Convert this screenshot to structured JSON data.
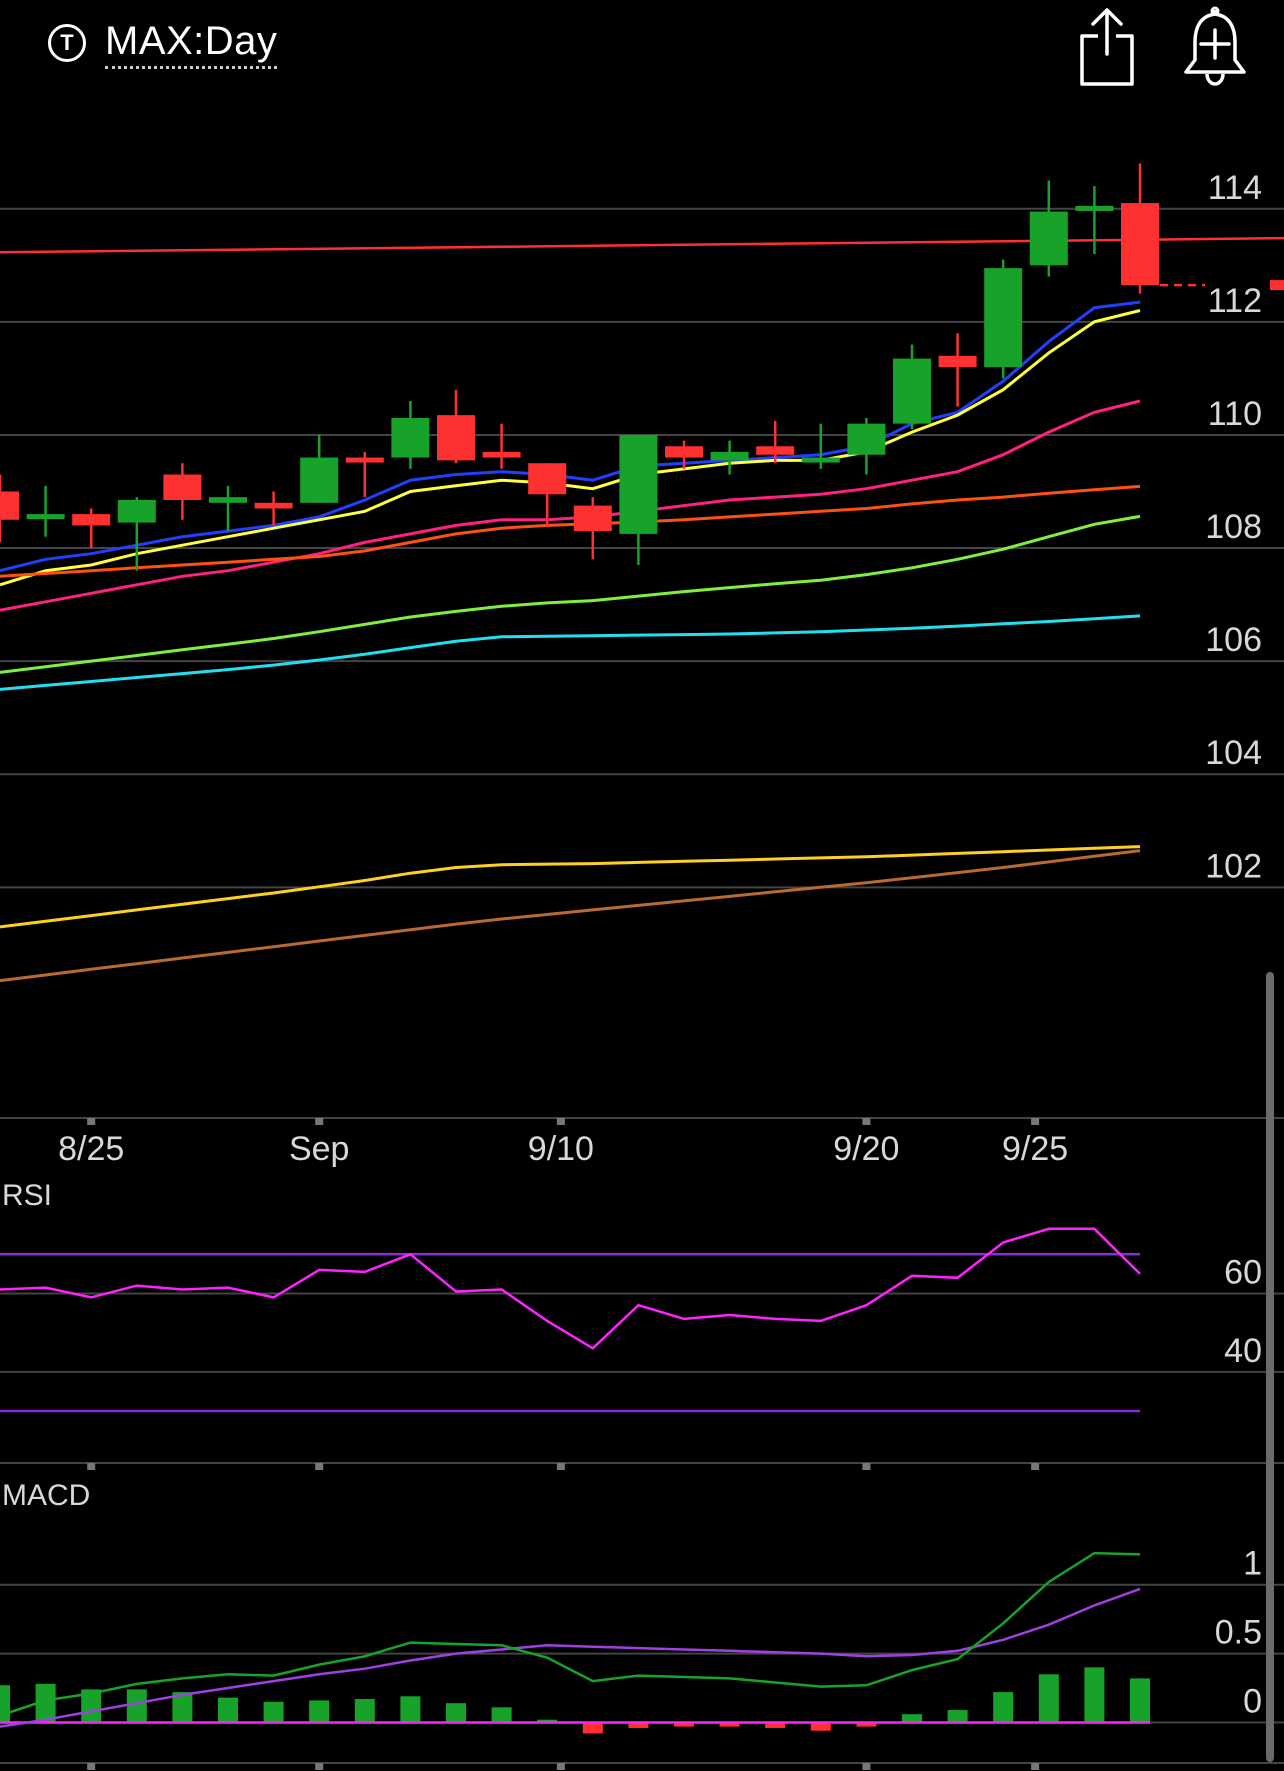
{
  "header": {
    "ticker_icon": "T",
    "title": "MAX:Day",
    "share_icon": "share-icon",
    "alert_icon": "add-alert-bell-icon"
  },
  "colors": {
    "up": "#17a32a",
    "down": "#ff3030",
    "grid": "#444444",
    "axis_text": "#d8d8d8",
    "rsi_line": "#ff22ff",
    "rsi_band": "#8a2be2",
    "macd_line": "#17a32a",
    "signal_line": "#a040e0",
    "macd_zero": "#ff22ff"
  },
  "chart_data": [
    {
      "type": "candlestick",
      "title": "MAX:Day",
      "y_ticks": [
        114,
        112,
        110,
        108,
        106,
        104,
        102
      ],
      "ylim": [
        99.3,
        116.1
      ],
      "x_ticks": [
        {
          "label": "8/25",
          "index": 2
        },
        {
          "label": "Sep",
          "index": 7
        },
        {
          "label": "9/10",
          "index": 12.3
        },
        {
          "label": "9/20",
          "index": 19
        },
        {
          "label": "9/25",
          "index": 22.7
        }
      ],
      "candles": [
        {
          "o": 109.0,
          "h": 109.3,
          "l": 108.1,
          "c": 108.5
        },
        {
          "o": 108.6,
          "h": 109.1,
          "l": 108.2,
          "c": 108.6
        },
        {
          "o": 108.6,
          "h": 108.7,
          "l": 108.0,
          "c": 108.4
        },
        {
          "o": 108.45,
          "h": 108.9,
          "l": 107.6,
          "c": 108.85
        },
        {
          "o": 109.3,
          "h": 109.5,
          "l": 108.5,
          "c": 108.85
        },
        {
          "o": 108.8,
          "h": 109.1,
          "l": 108.3,
          "c": 108.9
        },
        {
          "o": 108.8,
          "h": 109.0,
          "l": 108.4,
          "c": 108.7
        },
        {
          "o": 108.8,
          "h": 110.0,
          "l": 108.8,
          "c": 109.6
        },
        {
          "o": 109.6,
          "h": 109.7,
          "l": 108.9,
          "c": 109.55
        },
        {
          "o": 109.6,
          "h": 110.6,
          "l": 109.4,
          "c": 110.3
        },
        {
          "o": 110.35,
          "h": 110.8,
          "l": 109.5,
          "c": 109.55
        },
        {
          "o": 109.7,
          "h": 110.2,
          "l": 109.4,
          "c": 109.6
        },
        {
          "o": 109.5,
          "h": 109.5,
          "l": 108.4,
          "c": 108.95
        },
        {
          "o": 108.75,
          "h": 108.9,
          "l": 107.8,
          "c": 108.3
        },
        {
          "o": 108.25,
          "h": 110.0,
          "l": 107.7,
          "c": 110.0
        },
        {
          "o": 109.8,
          "h": 109.9,
          "l": 109.4,
          "c": 109.6
        },
        {
          "o": 109.55,
          "h": 109.9,
          "l": 109.3,
          "c": 109.7
        },
        {
          "o": 109.8,
          "h": 110.25,
          "l": 109.5,
          "c": 109.65
        },
        {
          "o": 109.55,
          "h": 110.2,
          "l": 109.4,
          "c": 109.6
        },
        {
          "o": 109.65,
          "h": 110.3,
          "l": 109.3,
          "c": 110.2
        },
        {
          "o": 110.2,
          "h": 111.6,
          "l": 110.1,
          "c": 111.35
        },
        {
          "o": 111.4,
          "h": 111.8,
          "l": 110.5,
          "c": 111.2
        },
        {
          "o": 111.2,
          "h": 113.1,
          "l": 111.0,
          "c": 112.95
        },
        {
          "o": 113.0,
          "h": 114.5,
          "l": 112.8,
          "c": 113.95
        },
        {
          "o": 114.0,
          "h": 114.4,
          "l": 113.2,
          "c": 114.05
        },
        {
          "o": 114.1,
          "h": 114.8,
          "l": 112.5,
          "c": 112.65
        }
      ],
      "series": [
        {
          "color": "#2040ff",
          "values": [
            107.6,
            107.8,
            107.9,
            108.05,
            108.2,
            108.3,
            108.4,
            108.55,
            108.85,
            109.2,
            109.3,
            109.35,
            109.3,
            109.2,
            109.45,
            109.5,
            109.55,
            109.6,
            109.65,
            109.8,
            110.2,
            110.4,
            110.95,
            111.65,
            112.25,
            112.35
          ]
        },
        {
          "color": "#ffff40",
          "values": [
            107.35,
            107.6,
            107.7,
            107.9,
            108.05,
            108.2,
            108.35,
            108.5,
            108.65,
            109.0,
            109.1,
            109.2,
            109.15,
            109.05,
            109.3,
            109.4,
            109.5,
            109.55,
            109.55,
            109.7,
            110.05,
            110.35,
            110.8,
            111.45,
            112.0,
            112.2
          ]
        },
        {
          "color": "#ff2080",
          "values": [
            106.9,
            107.05,
            107.2,
            107.35,
            107.5,
            107.6,
            107.75,
            107.9,
            108.1,
            108.25,
            108.4,
            108.5,
            108.5,
            108.55,
            108.65,
            108.75,
            108.85,
            108.9,
            108.95,
            109.05,
            109.2,
            109.35,
            109.65,
            110.05,
            110.4,
            110.6
          ]
        },
        {
          "color": "#ff5010",
          "values": [
            107.5,
            107.55,
            107.6,
            107.65,
            107.7,
            107.75,
            107.8,
            107.85,
            107.95,
            108.1,
            108.25,
            108.35,
            108.4,
            108.43,
            108.46,
            108.5,
            108.55,
            108.6,
            108.65,
            108.7,
            108.78,
            108.85,
            108.9,
            108.97,
            109.03,
            109.09
          ]
        },
        {
          "color": "#80f040",
          "values": [
            105.8,
            105.9,
            106.0,
            106.1,
            106.2,
            106.3,
            106.4,
            106.52,
            106.65,
            106.78,
            106.88,
            106.97,
            107.03,
            107.07,
            107.15,
            107.23,
            107.3,
            107.37,
            107.43,
            107.53,
            107.65,
            107.8,
            107.98,
            108.2,
            108.42,
            108.56
          ]
        },
        {
          "color": "#20e0f0",
          "values": [
            105.5,
            105.57,
            105.64,
            105.71,
            105.78,
            105.85,
            105.93,
            106.02,
            106.12,
            106.24,
            106.35,
            106.43,
            106.44,
            106.45,
            106.46,
            106.47,
            106.48,
            106.5,
            106.52,
            106.55,
            106.58,
            106.62,
            106.66,
            106.7,
            106.75,
            106.8
          ]
        },
        {
          "color": "#ffd020",
          "values": [
            101.3,
            101.4,
            101.5,
            101.6,
            101.7,
            101.8,
            101.9,
            102.01,
            102.12,
            102.25,
            102.35,
            102.4,
            102.41,
            102.42,
            102.44,
            102.46,
            102.48,
            102.5,
            102.52,
            102.54,
            102.57,
            102.6,
            102.63,
            102.66,
            102.69,
            102.72
          ]
        },
        {
          "color": "#b86a30",
          "values": [
            100.35,
            100.45,
            100.55,
            100.65,
            100.75,
            100.85,
            100.95,
            101.05,
            101.15,
            101.25,
            101.35,
            101.44,
            101.52,
            101.6,
            101.68,
            101.76,
            101.84,
            101.92,
            102.0,
            102.08,
            102.17,
            102.26,
            102.35,
            102.45,
            102.55,
            102.65
          ]
        }
      ],
      "reference_line": {
        "color": "#ff3030",
        "start": 113.23,
        "end": 113.48
      },
      "last_price": 112.65
    },
    {
      "type": "line",
      "title": "RSI",
      "y_ticks": [
        60,
        40
      ],
      "ylim": [
        22.6,
        81.3
      ],
      "bands": [
        70,
        30
      ],
      "values": [
        61,
        61.5,
        59,
        62,
        61,
        61.5,
        59,
        66,
        65.5,
        70,
        60.5,
        61,
        53,
        46,
        57,
        53.5,
        54.5,
        53.5,
        53,
        57,
        64.5,
        64,
        73,
        76.5,
        76.5,
        65
      ]
    },
    {
      "type": "bar",
      "title": "MACD",
      "y_ticks": [
        1,
        0.5,
        0
      ],
      "ylim": [
        -0.2,
        1.47
      ],
      "macd": [
        0.05,
        0.16,
        0.21,
        0.28,
        0.32,
        0.35,
        0.34,
        0.42,
        0.48,
        0.58,
        0.57,
        0.56,
        0.47,
        0.3,
        0.34,
        0.33,
        0.32,
        0.29,
        0.26,
        0.27,
        0.38,
        0.46,
        0.72,
        1.02,
        1.23,
        1.22
      ],
      "signal": [
        -0.03,
        0.02,
        0.08,
        0.14,
        0.2,
        0.25,
        0.3,
        0.35,
        0.39,
        0.45,
        0.5,
        0.53,
        0.56,
        0.55,
        0.54,
        0.53,
        0.52,
        0.51,
        0.5,
        0.48,
        0.49,
        0.52,
        0.6,
        0.71,
        0.85,
        0.97
      ],
      "histogram": [
        0.27,
        0.28,
        0.24,
        0.24,
        0.22,
        0.18,
        0.15,
        0.16,
        0.17,
        0.19,
        0.14,
        0.11,
        0.02,
        -0.08,
        -0.04,
        -0.03,
        -0.03,
        -0.04,
        -0.06,
        -0.03,
        0.06,
        0.09,
        0.22,
        0.35,
        0.4,
        0.32
      ]
    }
  ]
}
